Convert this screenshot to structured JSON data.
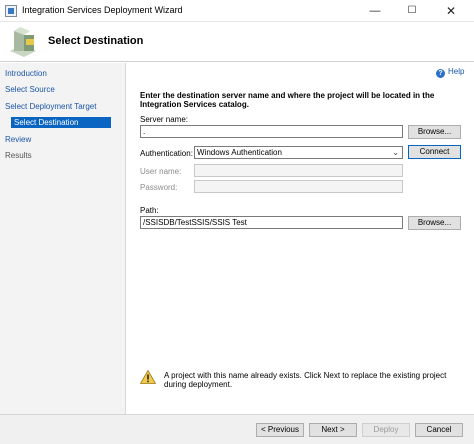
{
  "window": {
    "title": "Integration Services Deployment Wizard",
    "minimize_glyph": "—",
    "maximize_glyph": "☐",
    "close_glyph": "✕"
  },
  "header": {
    "title": "Select Destination"
  },
  "sidebar": {
    "items": [
      {
        "label": "Introduction",
        "state": "link"
      },
      {
        "label": "Select Source",
        "state": "link"
      },
      {
        "label": "Select Deployment Target",
        "state": "link"
      },
      {
        "label": "Select Destination",
        "state": "active"
      },
      {
        "label": "Review",
        "state": "link"
      },
      {
        "label": "Results",
        "state": "plain"
      }
    ]
  },
  "content": {
    "help_label": "Help",
    "help_glyph": "?",
    "instruction": "Enter the destination server name and where the project will be located in the Integration Services catalog.",
    "server_name": {
      "label": "Server name:",
      "value": ".",
      "browse_label": "Browse..."
    },
    "authentication": {
      "label": "Authentication:",
      "value": "Windows Authentication",
      "chevron": "⌄",
      "connect_label": "Connect"
    },
    "user_name": {
      "label": "User name:",
      "value": ""
    },
    "password": {
      "label": "Password:",
      "value": ""
    },
    "path": {
      "label": "Path:",
      "value": "/SSISDB/TestSSIS/SSIS Test",
      "browse_label": "Browse..."
    },
    "warning": {
      "text": "A project with this name already exists. Click Next to replace the existing project during deployment.",
      "icon": "warning-icon",
      "color": "#f2c94c"
    }
  },
  "footer": {
    "previous_label": "< Previous",
    "next_label": "Next >",
    "deploy_label": "Deploy",
    "cancel_label": "Cancel"
  },
  "colors": {
    "active_nav": "#0a64c2",
    "link": "#1a55a8",
    "focus_border": "#0a64c2"
  }
}
